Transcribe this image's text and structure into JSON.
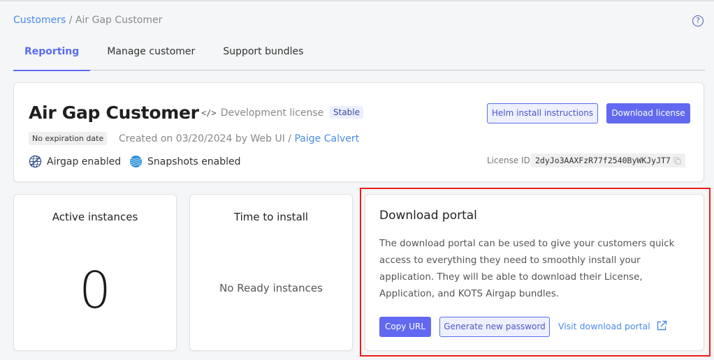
{
  "breadcrumb": {
    "root": "Customers",
    "separator": " / ",
    "current": "Air Gap Customer"
  },
  "help_icon": "?",
  "tabs": [
    {
      "label": "Reporting",
      "active": true
    },
    {
      "label": "Manage customer",
      "active": false
    },
    {
      "label": "Support bundles",
      "active": false
    }
  ],
  "customer": {
    "name": "Air Gap Customer",
    "license_type_icon": "</>",
    "license_type": "Development license",
    "channel_badge": "Stable",
    "expiration_badge": "No expiration date",
    "created_prefix": "Created on 03/20/2024 by Web UI / ",
    "created_by": "Paige Calvert",
    "features": [
      {
        "icon": "airgap-icon",
        "label": "Airgap enabled"
      },
      {
        "icon": "snapshots-icon",
        "label": "Snapshots enabled"
      }
    ],
    "buttons": {
      "helm": "Helm install instructions",
      "download_license": "Download license"
    },
    "license_id_label": "License ID:",
    "license_id": "2dyJo3AAXFzR77f2540ByWKJyJT7"
  },
  "stats": {
    "active_instances": {
      "title": "Active instances",
      "value": "0"
    },
    "time_to_install": {
      "title": "Time to install",
      "value": "No Ready instances"
    }
  },
  "download_portal": {
    "title": "Download portal",
    "description": "The download portal can be used to give your customers quick access to everything they need to smoothly install your application. They will be able to download their License, Application, and KOTS Airgap bundles.",
    "copy_url": "Copy URL",
    "generate_password": "Generate new password",
    "visit_link": "Visit download portal"
  },
  "colors": {
    "accent": "#6269f0",
    "link": "#4a8ae8",
    "highlight_border": "#ee1c1c"
  }
}
